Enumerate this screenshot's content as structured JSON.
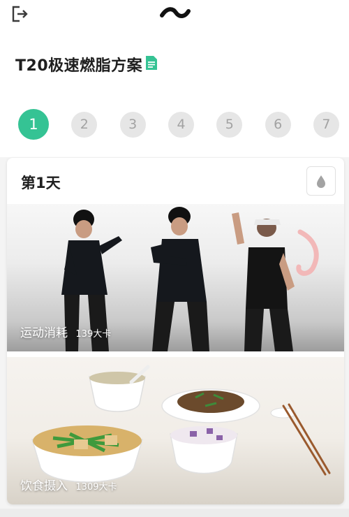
{
  "colors": {
    "accent": "#35c394",
    "step_inactive_bg": "#e6e6e6",
    "step_inactive_text": "#a2a2a2"
  },
  "topbar": {
    "exit_icon": "exit-icon",
    "brand_icon": "tilde-logo-icon"
  },
  "plan": {
    "title": "T20极速燃脂方案",
    "doc_icon": "document-icon"
  },
  "days": {
    "selected": "1",
    "items": [
      "1",
      "2",
      "3",
      "4",
      "5",
      "6",
      "7"
    ]
  },
  "card": {
    "day_title": "第1天",
    "drop_icon": "water-drop-icon",
    "exercise": {
      "label": "运动消耗",
      "calories": "139大卡"
    },
    "diet": {
      "label": "饮食摄入",
      "calories": "1309大卡"
    }
  }
}
